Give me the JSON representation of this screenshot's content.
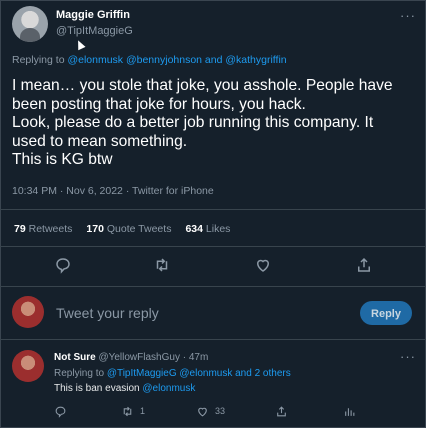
{
  "tweet": {
    "author_name": "Maggie Griffin",
    "author_handle": "@TipItMaggieG",
    "more": "···",
    "replying_prefix": "Replying to ",
    "replying_to": "@elonmusk @bennyjohnson and @kathygriffin",
    "text_lines": [
      "I mean… you stole that joke, you asshole. People have",
      "been posting that joke for hours, you hack.",
      "Look, please do a better job running this company. It",
      "used to mean something.",
      "This is KG btw"
    ],
    "meta": "10:34 PM · Nov 6, 2022 · Twitter for iPhone",
    "stats": {
      "retweets_count": "79",
      "retweets_label": "Retweets",
      "quotes_count": "170",
      "quotes_label": "Quote Tweets",
      "likes_count": "634",
      "likes_label": "Likes"
    }
  },
  "composer": {
    "placeholder": "Tweet your reply",
    "button_label": "Reply"
  },
  "reply": {
    "author_name": "Not Sure",
    "author_handle": "@YellowFlashGuy",
    "time": "· 47m",
    "more": "···",
    "replying_prefix": "Replying to ",
    "replying_to": "@TipItMaggieG @elonmusk and 2 others",
    "text_prefix": "This is ban evasion ",
    "text_mention": "@elonmusk",
    "retweet_count": "1",
    "like_count": "33"
  },
  "colors": {
    "background": "#15202b",
    "accent": "#1d9bf0",
    "secondary_text": "#8b98a5"
  }
}
